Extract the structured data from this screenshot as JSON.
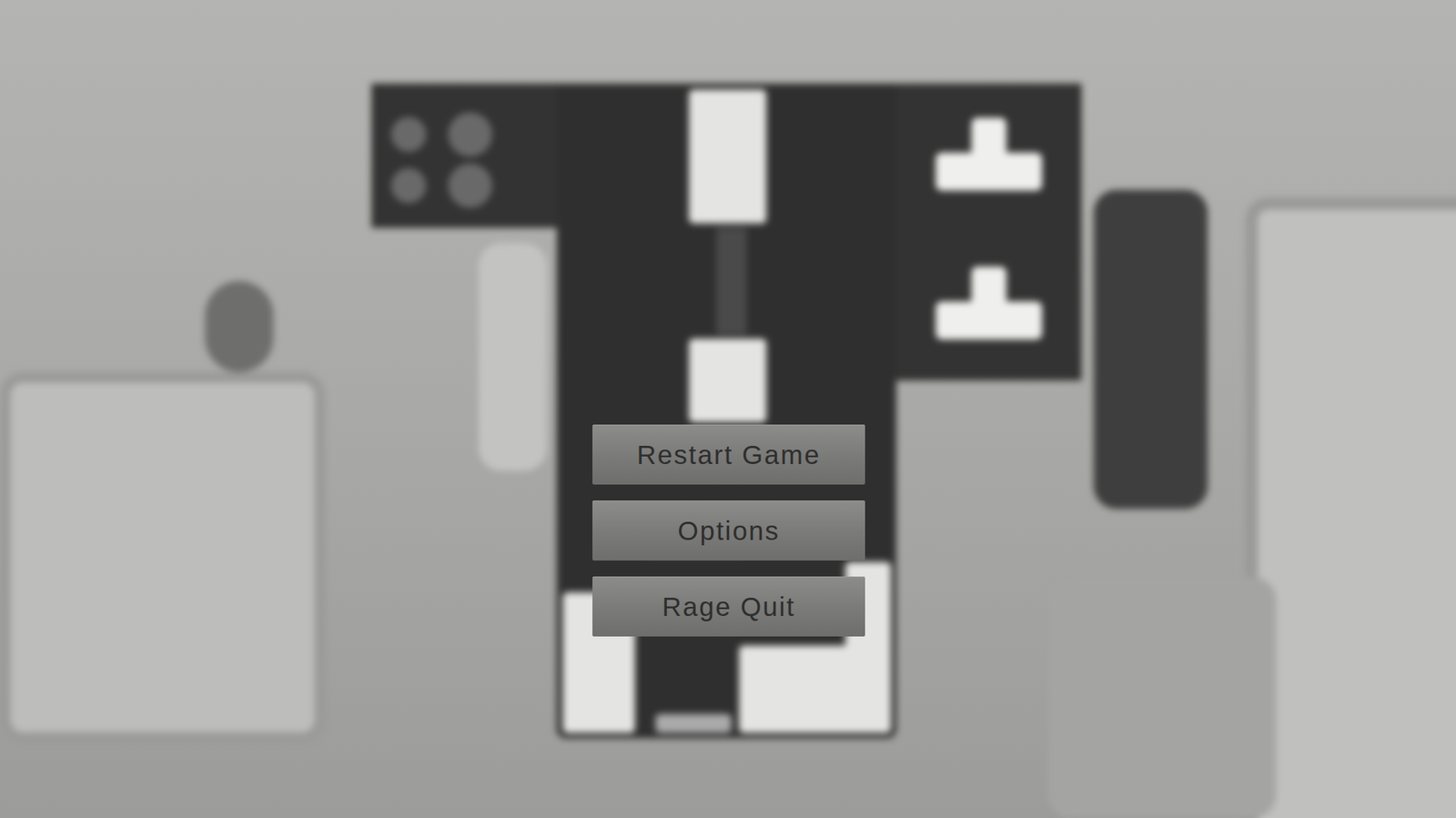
{
  "pause_menu": {
    "buttons": [
      {
        "label": "Restart Game"
      },
      {
        "label": "Options"
      },
      {
        "label": "Rage Quit"
      }
    ]
  }
}
